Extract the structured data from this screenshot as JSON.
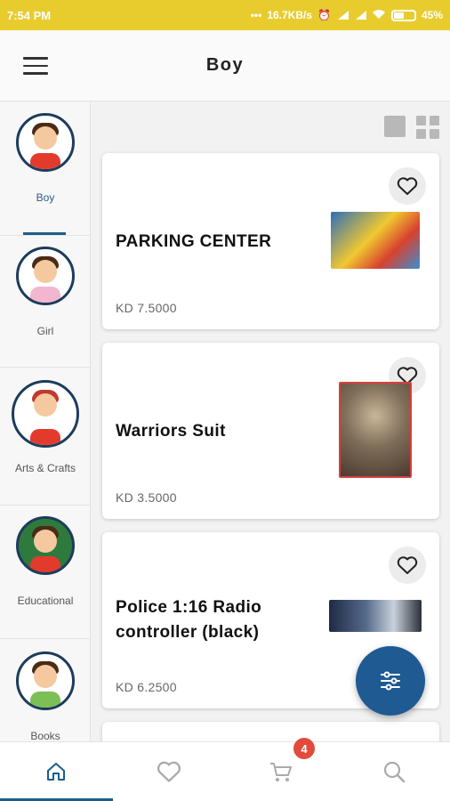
{
  "status_bar": {
    "time": "7:54 PM",
    "speed": "16.7KB/s",
    "battery": "45%"
  },
  "app_bar": {
    "title": "Boy"
  },
  "categories": [
    {
      "label": "Boy",
      "active": true
    },
    {
      "label": "Girl",
      "active": false
    },
    {
      "label": "Arts & Crafts",
      "active": false
    },
    {
      "label": "Educational",
      "active": false
    },
    {
      "label": "Books",
      "active": false
    }
  ],
  "products": [
    {
      "name": "PARKING CENTER",
      "price": "KD 7.5000"
    },
    {
      "name": "Warriors Suit",
      "price": "KD 3.5000"
    },
    {
      "name": "Police 1:16 Radio controller (black)",
      "price": "KD 6.2500"
    }
  ],
  "bottom_nav": {
    "cart_badge": "4",
    "active": "home"
  },
  "colors": {
    "status_bar": "#e8cc2e",
    "accent": "#1d5d8a",
    "fab": "#1f5a93",
    "badge": "#e24b3b"
  },
  "icons": {
    "menu": "hamburger-icon",
    "view_single": "single-view-icon",
    "view_grid": "grid-view-icon",
    "favorite": "heart-icon",
    "filter": "filter-sliders-icon",
    "home": "home-icon",
    "wishlist": "heart-icon",
    "cart": "cart-icon",
    "search": "search-icon"
  }
}
